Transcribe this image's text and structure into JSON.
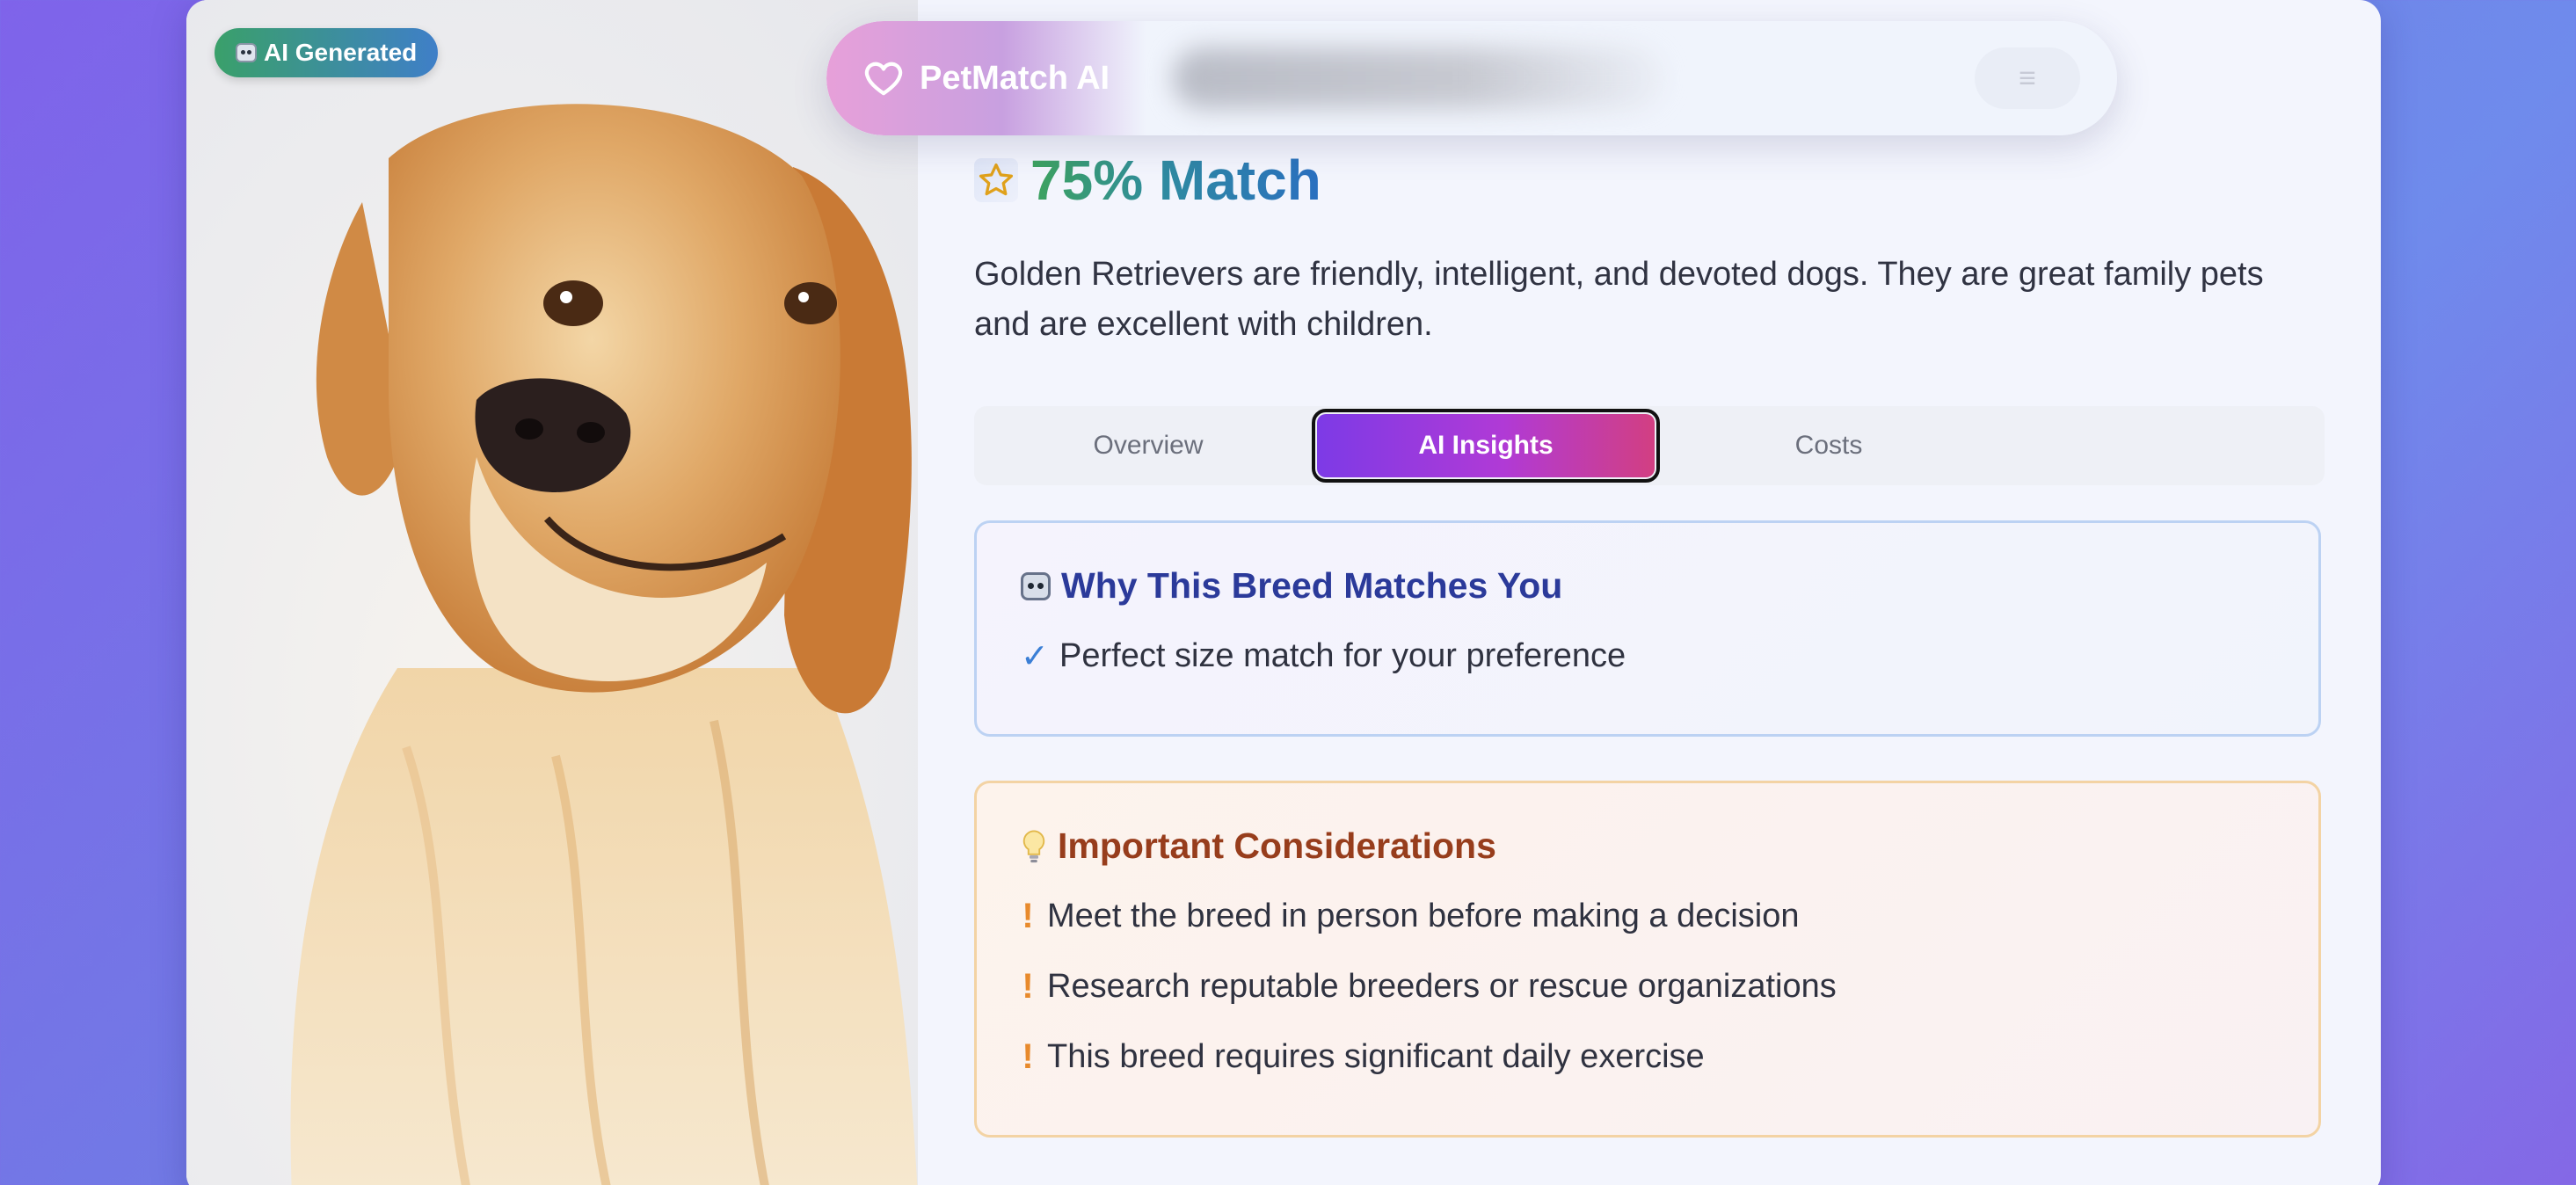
{
  "badge": {
    "label": "AI Generated",
    "icon": "robot-icon"
  },
  "navbar": {
    "brand": "PetMatch AI",
    "brand_icon": "heart-icon",
    "menu_icon": "menu-icon",
    "menu_glyph": "≡"
  },
  "match": {
    "label": "75% Match",
    "percent": 75,
    "icon": "star-icon"
  },
  "description": "Golden Retrievers are friendly, intelligent, and devoted dogs. They are great family pets and are excellent with children.",
  "tabs": [
    {
      "label": "Overview",
      "active": false
    },
    {
      "label": "AI Insights",
      "active": true
    },
    {
      "label": "Costs",
      "active": false
    }
  ],
  "why": {
    "title": "Why This Breed Matches You",
    "icon": "robot-icon",
    "check_glyph": "✓",
    "items": [
      "Perfect size match for your preference"
    ]
  },
  "considerations": {
    "title": "Important Considerations",
    "icon": "lightbulb-icon",
    "warn_glyph": "!",
    "items": [
      "Meet the breed in person before making a decision",
      "Research reputable breeders or rescue organizations",
      "This breed requires significant daily exercise"
    ]
  },
  "colors": {
    "accent_purple": "#7d3ae6",
    "accent_pink": "#d23f82",
    "match_green": "#3da35d",
    "match_blue": "#2a6fc0",
    "why_title": "#2b3a9a",
    "consider_title": "#973d1c",
    "check": "#3b7fd6",
    "warning": "#e88a2c"
  }
}
